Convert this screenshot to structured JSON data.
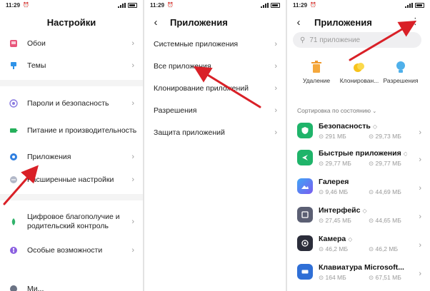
{
  "status": {
    "time": "11:29"
  },
  "settings": {
    "title": "Настройки",
    "items": [
      {
        "label": "Обои"
      },
      {
        "label": "Темы"
      },
      {
        "label": "Пароли и безопасность"
      },
      {
        "label": "Питание и производительность"
      },
      {
        "label": "Приложения"
      },
      {
        "label": "Расширенные настройки"
      },
      {
        "label": "Цифровое благополучие и родительский контроль"
      },
      {
        "label": "Особые возможности"
      },
      {
        "label": "Ми..."
      }
    ]
  },
  "apps_menu": {
    "title": "Приложения",
    "items": [
      {
        "label": "Системные приложения"
      },
      {
        "label": "Все приложения"
      },
      {
        "label": "Клонирование приложений"
      },
      {
        "label": "Разрешения"
      },
      {
        "label": "Защита приложений"
      }
    ]
  },
  "apps_list": {
    "title": "Приложения",
    "search_placeholder": "71 приложение",
    "actions": [
      {
        "label": "Удаление"
      },
      {
        "label": "Клонирован..."
      },
      {
        "label": "Разрешения"
      }
    ],
    "sort_label": "Сортировка по состоянию",
    "apps": [
      {
        "name": "Безопасность",
        "size": "291 МБ",
        "cache": "29,73 МБ",
        "color": "#1fb46a"
      },
      {
        "name": "Быстрые приложения",
        "size": "29,77 МБ",
        "cache": "29,77 МБ",
        "color": "#1fb46a"
      },
      {
        "name": "Галерея",
        "size": "9,46 МБ",
        "cache": "44,69 МБ",
        "color": "#4d7ff0"
      },
      {
        "name": "Интерфейс",
        "size": "27,45 МБ",
        "cache": "44,65 МБ",
        "color": "#5b5f73"
      },
      {
        "name": "Камера",
        "size": "46,2 МБ",
        "cache": "46,2 МБ",
        "color": "#2b2d3a"
      },
      {
        "name": "Клавиатура Microsoft...",
        "size": "164 МБ",
        "cache": "67,51 МБ",
        "color": "#2f6fd6"
      }
    ]
  },
  "colors": {
    "accent_arrow": "#d92027",
    "chevron": "#9a9a9a",
    "search_bg": "#efeff1"
  }
}
